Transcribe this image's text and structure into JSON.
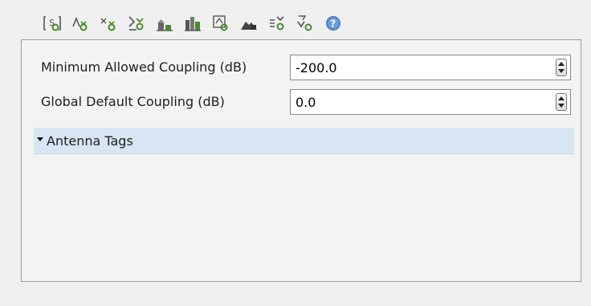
{
  "toolbar": {
    "icons": [
      "select-antenna-icon",
      "add-antenna-icon",
      "add-tagged-antenna-icon",
      "antenna-coupling-icon",
      "building-coupling-icon",
      "city-coupling-icon",
      "antenna-frame-icon",
      "terrain-icon",
      "antenna-group-icon",
      "antenna-tag-icon",
      "help-icon"
    ]
  },
  "fields": [
    {
      "label": "Minimum Allowed Coupling (dB)",
      "value": "-200.0"
    },
    {
      "label": "Global Default Coupling (dB)",
      "value": "0.0"
    }
  ],
  "section": {
    "title": "Antenna Tags",
    "expanded": true
  },
  "colors": {
    "icon_green": "#4a8a2c",
    "icon_gray": "#555555",
    "help_blue": "#4a80c8",
    "section_bg": "#d8e6f3"
  }
}
